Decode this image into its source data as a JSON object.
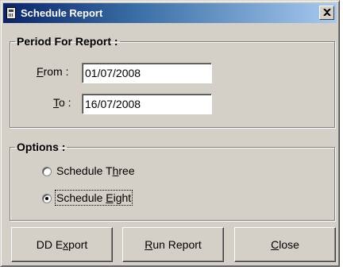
{
  "window": {
    "title": "Schedule Report",
    "close_glyph": "✕"
  },
  "period": {
    "legend": "Period For Report :",
    "from_label_key": "F",
    "from_label_rest": "rom :",
    "from_value": "01/07/2008",
    "to_label_key": "T",
    "to_label_rest": "o :",
    "to_value": "16/07/2008"
  },
  "options": {
    "legend": "Options :",
    "items": [
      {
        "pre": "Schedule T",
        "key": "h",
        "post": "ree",
        "checked": false
      },
      {
        "pre": "Schedule ",
        "key": "E",
        "post": "ight",
        "checked": true
      }
    ]
  },
  "buttons": {
    "dd_export": {
      "pre": "DD E",
      "key": "x",
      "post": "port"
    },
    "run_report": {
      "pre": "",
      "key": "R",
      "post": "un Report"
    },
    "close": {
      "pre": "",
      "key": "C",
      "post": "lose"
    }
  },
  "icons": {
    "title_icon": "report-icon",
    "close_icon": "close-icon"
  }
}
